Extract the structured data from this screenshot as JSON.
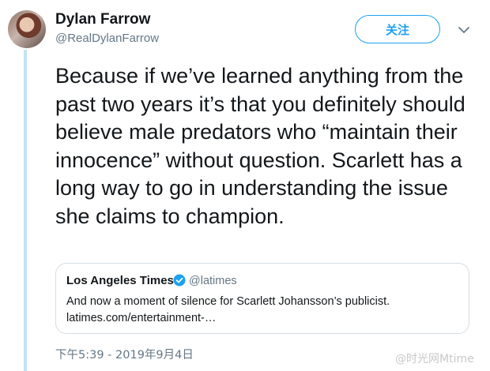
{
  "author": {
    "name": "Dylan Farrow",
    "handle": "@RealDylanFarrow"
  },
  "follow_button": "关注",
  "tweet_text": "Because if we’ve learned anything from the past two years it’s that you definitely should believe male predators who “maintain their innocence” without question. Scarlett has a long way to go in understanding the issue she claims to champion.",
  "quoted_tweet": {
    "name": "Los Angeles Times",
    "handle": "@latimes",
    "text": "And now a moment of silence for Scarlett Johansson’s publicist.",
    "link": "latimes.com/entertainment-…"
  },
  "timestamp": "下午5:39 - 2019年9月4日",
  "watermark": "@时光网Mtime",
  "colors": {
    "accent": "#1da1f2",
    "thread_line": "#c4e3f5",
    "secondary_text": "#657786"
  },
  "icons": {
    "chevron": "chevron-down-icon",
    "verified": "verified-badge-icon"
  }
}
